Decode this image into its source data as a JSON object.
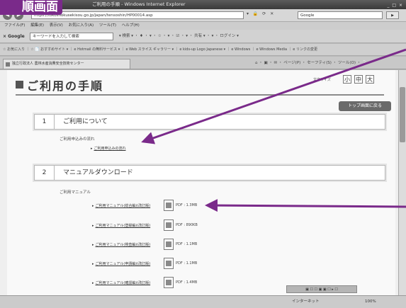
{
  "screen_label": "順画面",
  "browser": {
    "title": "ご利用の手順 - Windows Internet Explorer",
    "window_controls": "_ □ ×",
    "address": "https://tokoshokusekisou.go.jp/japan/tensoshin/HP00014.asp",
    "search_placeholder": "Google",
    "search_go": "▶",
    "menu": [
      "ファイル(F)",
      "編集(E)",
      "表示(V)",
      "お気に入り(A)",
      "ツール(T)",
      "ヘルプ(H)"
    ],
    "google_logo": "× Google",
    "google_input_placeholder": "キーワードを入力して検索",
    "google_tools": "▾ 検索 ▾ ・ ♦ ・ ▾ ・ ☆ ・ ▾ ・ ☑ ・ ▾ ・ 共有 ▾ ・ ▾ ・ ログイン ▾",
    "favorites": "☆ お気に入り ｜ ☆ 📄 おすすめサイト ▾ ｜ e Hotmail の無料サービス ▾ ｜ e Web スライス ギャラリー ▾ ｜ e kids-up Logo Japanese ▾ ｜ e Windows ｜ e Windows Media ｜ e リンクの変更",
    "tab_label": "独立行政法人 農林水産消費安全技術センター",
    "command_bar": "⌂ ・ ▣ ・ ✉ ・ ページ(P) ・ セーフティ(S) ・ ツール(O) ・ ❔ ・",
    "status_zone": "インターネット",
    "status_zoom": "100%",
    "float_tools": "▣ ☐ ☐ ▣ ▣ ☐ ▸ ☐"
  },
  "page": {
    "title": "ご利用の手順",
    "fontsize_label": "文字サイズ",
    "fontsize_buttons": [
      "小",
      "中",
      "大"
    ],
    "top_return": "トップ画面に戻る",
    "sections": [
      {
        "number": "1",
        "title": "ご利用について",
        "sub_heading": "ご利用申込みの流れ",
        "links": [
          {
            "label": "ご利用申込みの流れ"
          }
        ]
      },
      {
        "number": "2",
        "title": "マニュアルダウンロード",
        "sub_heading": "ご利用マニュアル",
        "links": [
          {
            "label": "ご利用マニュアル(総合編)(改訂版)",
            "size": "PDF : 1.3MB"
          },
          {
            "label": "ご利用マニュアル(登録編)(改訂版)",
            "size": "PDF : 890KB"
          },
          {
            "label": "ご利用マニュアル(検査編)(改訂版)",
            "size": "PDF : 1.1MB"
          },
          {
            "label": "ご利用マニュアル(申請編)(改訂版)",
            "size": "PDF : 1.1MB"
          },
          {
            "label": "ご利用マニュアル(確認編)(改訂版)",
            "size": "PDF : 1.4MB"
          }
        ]
      }
    ]
  },
  "colors": {
    "annotation": "#7a2a8a",
    "button_dark": "#6a6a6a"
  },
  "icons": [
    "back-icon",
    "forward-icon",
    "pdf-icon",
    "tab-page-icon"
  ]
}
